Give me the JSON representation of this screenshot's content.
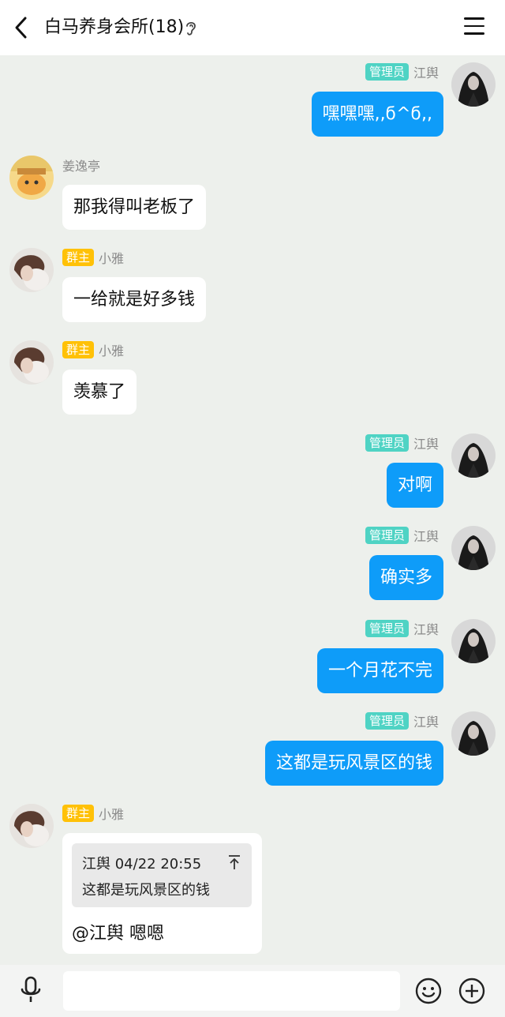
{
  "header": {
    "title": "白马养身会所(18)"
  },
  "badges": {
    "admin": "管理员",
    "owner": "群主"
  },
  "messages": [
    {
      "side": "right",
      "badge": "管理员",
      "name": "江舆",
      "text": "嘿嘿嘿,,ϭ^ϭ,,"
    },
    {
      "side": "left",
      "badge": "",
      "name": "姜逸亭",
      "text": "那我得叫老板了"
    },
    {
      "side": "left",
      "badge": "群主",
      "name": "小雅",
      "text": "一给就是好多钱"
    },
    {
      "side": "left",
      "badge": "群主",
      "name": "小雅",
      "text": "羡慕了"
    },
    {
      "side": "right",
      "badge": "管理员",
      "name": "江舆",
      "text": "对啊"
    },
    {
      "side": "right",
      "badge": "管理员",
      "name": "江舆",
      "text": "确实多"
    },
    {
      "side": "right",
      "badge": "管理员",
      "name": "江舆",
      "text": "一个月花不完"
    },
    {
      "side": "right",
      "badge": "管理员",
      "name": "江舆",
      "text": "这都是玩风景区的钱"
    }
  ],
  "quote_message": {
    "badge": "群主",
    "name": "小雅",
    "quote_header": "江舆 04/22 20:55",
    "quote_text": "这都是玩风景区的钱",
    "reply_text": "@江舆 嗯嗯"
  },
  "input": {
    "value": "",
    "placeholder": ""
  },
  "colors": {
    "bubble_self": "#0e9cf9",
    "bubble_other": "#ffffff",
    "background": "#edf0ec",
    "admin_badge": "#4fd3c4",
    "owner_badge": "#ffc107"
  }
}
